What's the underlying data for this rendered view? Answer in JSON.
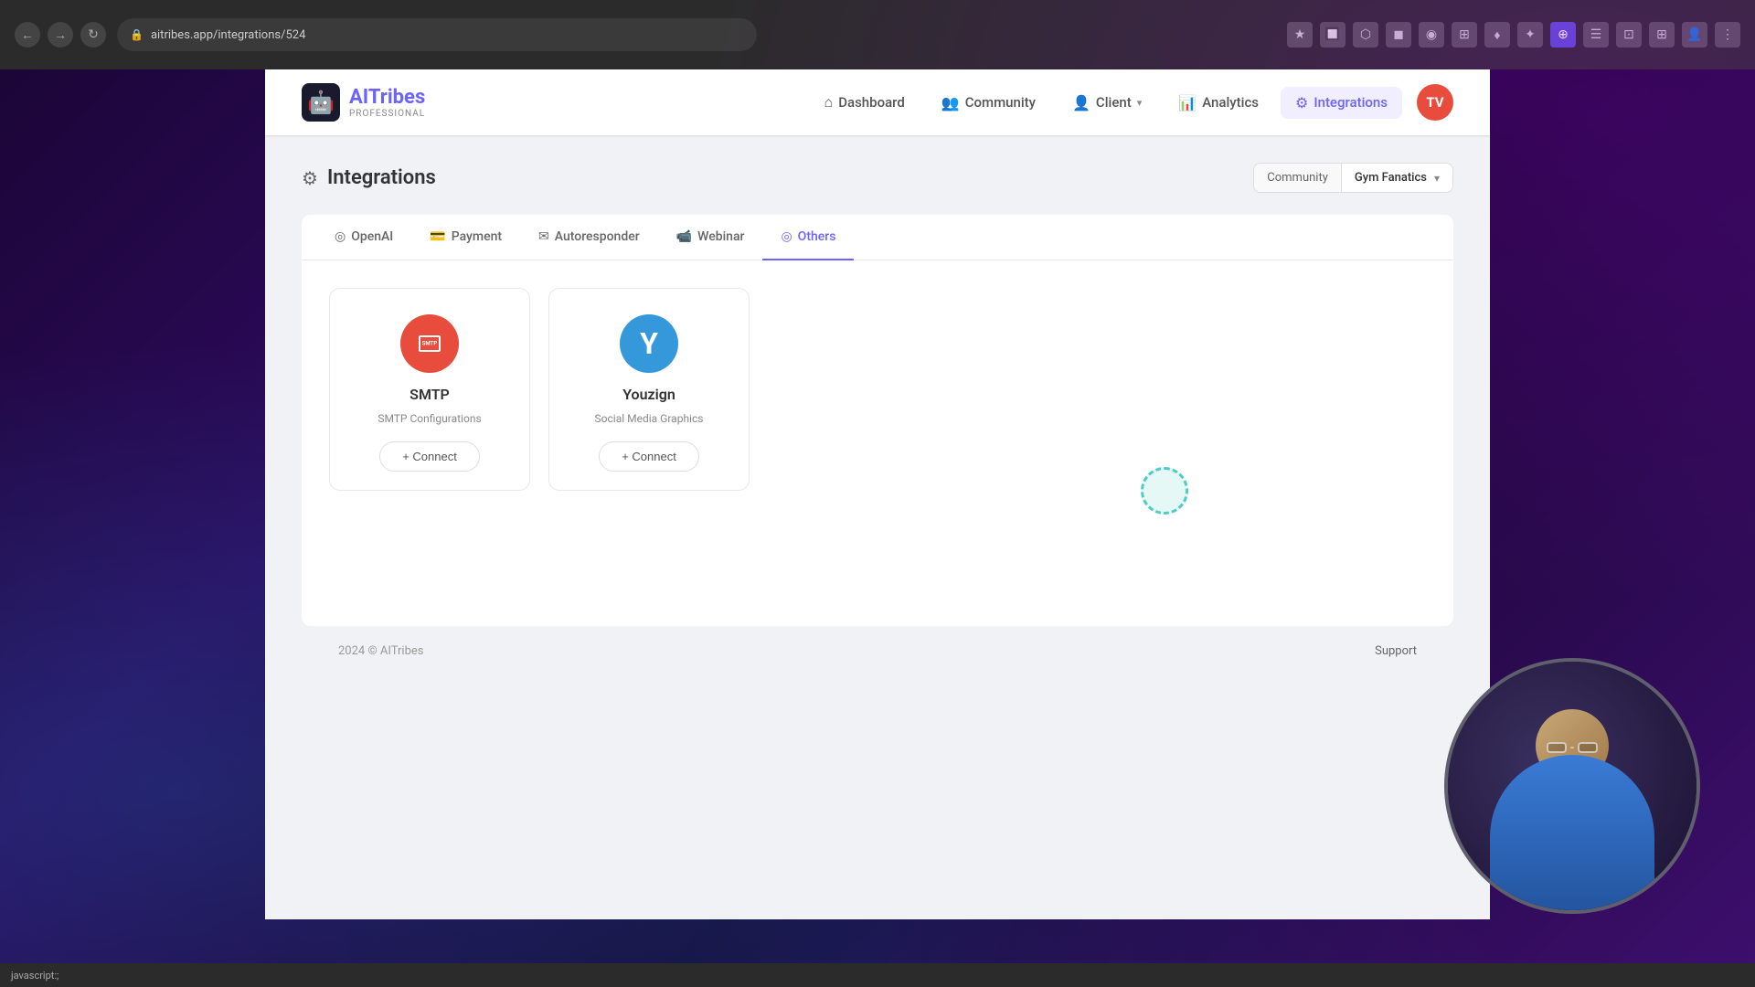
{
  "browser": {
    "url": "aitribes.app/integrations/524",
    "back_btn": "←",
    "forward_btn": "→",
    "refresh_btn": "↻"
  },
  "nav": {
    "logo_name": "AITribes",
    "logo_highlight": "AI",
    "logo_sub": "PROFESSIONAL",
    "logo_emoji": "🤖",
    "items": [
      {
        "id": "dashboard",
        "label": "Dashboard",
        "icon": "⌂",
        "active": false
      },
      {
        "id": "community",
        "label": "Community",
        "icon": "👥",
        "active": false
      },
      {
        "id": "client",
        "label": "Client",
        "icon": "👤",
        "has_arrow": true,
        "active": false
      },
      {
        "id": "analytics",
        "label": "Analytics",
        "icon": "📊",
        "active": false
      },
      {
        "id": "integrations",
        "label": "Integrations",
        "icon": "⚙",
        "active": true
      }
    ],
    "user_initials": "TV"
  },
  "page": {
    "title": "Integrations",
    "title_icon": "⚙"
  },
  "community_selector": {
    "label": "Community",
    "value": "Gym Fanatics"
  },
  "tabs": [
    {
      "id": "openai",
      "label": "OpenAI",
      "icon": "◎",
      "active": false
    },
    {
      "id": "payment",
      "label": "Payment",
      "icon": "💳",
      "active": false
    },
    {
      "id": "autoresponder",
      "label": "Autoresponder",
      "icon": "✉",
      "active": false
    },
    {
      "id": "webinar",
      "label": "Webinar",
      "icon": "📹",
      "active": false
    },
    {
      "id": "others",
      "label": "Others",
      "icon": "◎",
      "active": true
    }
  ],
  "integrations": [
    {
      "id": "smtp",
      "name": "SMTP",
      "description": "SMTP Configurations",
      "type": "smtp",
      "connect_label": "+ Connect"
    },
    {
      "id": "youzign",
      "name": "Youzign",
      "description": "Social Media Graphics",
      "type": "youzign",
      "connect_label": "+ Connect"
    }
  ],
  "footer": {
    "copyright": "2024 © AITribes",
    "support_label": "Support"
  },
  "status_bar": {
    "text": "javascript:;"
  }
}
